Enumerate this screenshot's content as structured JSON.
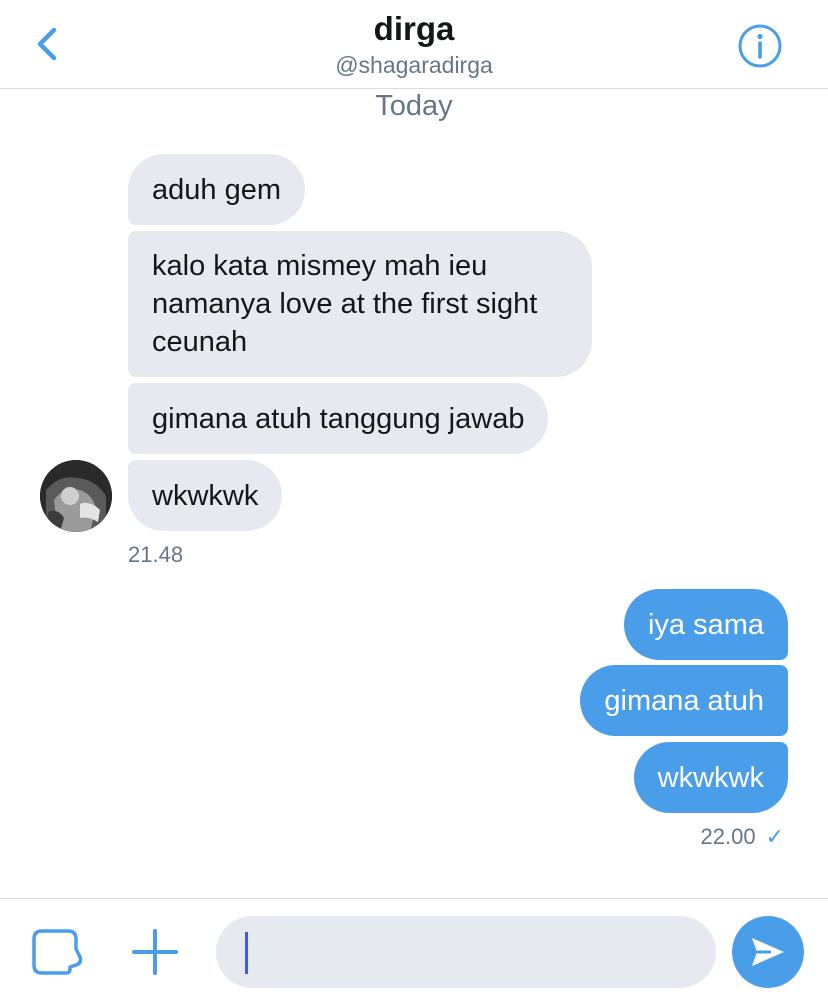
{
  "header": {
    "name": "dirga",
    "handle": "@shagaradirga",
    "back_icon": "chevron-left-icon",
    "info_icon": "info-icon"
  },
  "day_separator": "Today",
  "incoming": {
    "messages": [
      "aduh gem",
      "kalo kata mismey mah ieu namanya love at the first sight ceunah",
      "gimana atuh tanggung jawab",
      "wkwkwk"
    ],
    "time": "21.48"
  },
  "outgoing": {
    "messages": [
      "iya sama",
      "gimana atuh",
      "wkwkwk"
    ],
    "time": "22.00",
    "status_mark": "✓"
  },
  "composer": {
    "value": "",
    "placeholder": "",
    "gif_icon": "media-icon",
    "add_icon": "plus-icon",
    "send_icon": "send-icon"
  },
  "colors": {
    "accent": "#4a9de8",
    "incoming_bubble": "#e6e9ef",
    "secondary_text": "#657786"
  }
}
